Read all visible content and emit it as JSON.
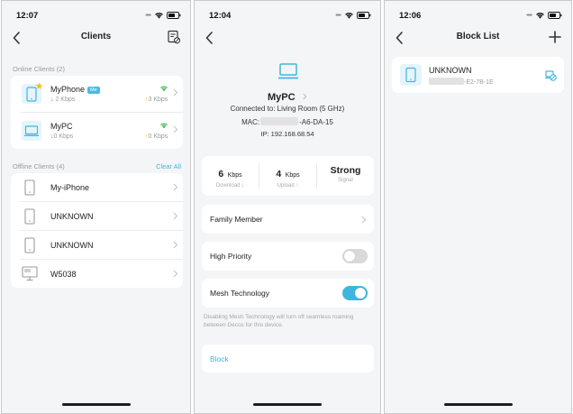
{
  "screen1": {
    "time": "12:07",
    "title": "Clients",
    "online_label": "Online Clients (2)",
    "online": [
      {
        "name": "MyPhone",
        "badge": "Me",
        "down": "2 Kbps",
        "up": "3 Kbps"
      },
      {
        "name": "MyPC",
        "down": "0 Kbps",
        "up": "0 Kbps"
      }
    ],
    "offline_label": "Offline Clients (4)",
    "clear_all": "Clear All",
    "offline": [
      {
        "name": "My-iPhone"
      },
      {
        "name": "UNKNOWN"
      },
      {
        "name": "UNKNOWN"
      },
      {
        "name": "W5038"
      }
    ]
  },
  "screen2": {
    "time": "12:04",
    "device_name": "MyPC",
    "connected": "Connected to: Living Room (5 GHz)",
    "mac_label": "MAC:",
    "mac_tail": "-A6-DA-15",
    "ip": "IP: 192.168.68.54",
    "stats": {
      "download_value": "6",
      "download_unit": "Kbps",
      "download_label": "Download",
      "upload_value": "4",
      "upload_unit": "Kbps",
      "upload_label": "Upload",
      "signal_value": "Strong",
      "signal_label": "Signal"
    },
    "family_member": "Family Member",
    "high_priority": "High Priority",
    "mesh": "Mesh Technology",
    "mesh_note": "Disabling Mesh Technology will turn off seamless roaming between Decos for this device.",
    "block": "Block"
  },
  "screen3": {
    "time": "12:06",
    "title": "Block List",
    "item_name": "UNKNOWN",
    "item_mac_tail": "-E2-7B-1E"
  },
  "colors": {
    "accent": "#3fb6df",
    "toggle_on": "#3fb6df",
    "toggle_off": "#d8d8d8",
    "green": "#3ab54a",
    "orange": "#f5a623"
  }
}
